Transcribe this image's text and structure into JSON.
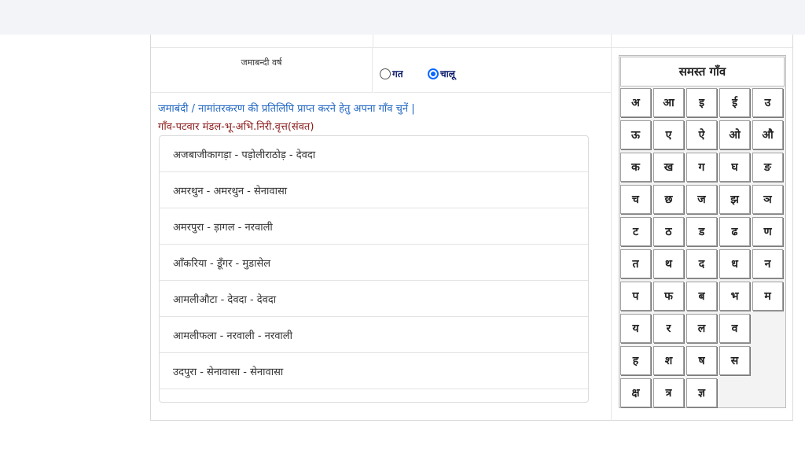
{
  "labels": {
    "year": "जमाबन्दी वर्ष"
  },
  "radios": [
    {
      "label": "गत",
      "checked": false
    },
    {
      "label": "चालू",
      "checked": true
    }
  ],
  "instructions": {
    "main": "जमाबंदी / नामांतरकरण की प्रतिलिपि प्राप्त करने हेतु अपना गाँव चुनें |",
    "sub": "गाँव-पटवार मंडल-भू-अभि.निरी.वृत्त(संवत)"
  },
  "villages": [
    "अजबाजीकागड़ा - पड़ोलीराठोड़ - देवदा",
    "अमरथुन - अमरथुन - सेनावासा",
    "अमरपुरा - ड़ागल - नरवाली",
    "आँकरिया - डूँगर - मुडासेल",
    "आमलीऔटा - देवदा - देवदा",
    "आमलीफला - नरवाली - नरवाली",
    "उदपुरा - सेनावासा - सेनावासा"
  ],
  "panel": {
    "title": "समस्त गाँव",
    "rows": [
      [
        "अ",
        "आ",
        "इ",
        "ई",
        "उ"
      ],
      [
        "ऊ",
        "ए",
        "ऐ",
        "ओ",
        "औ"
      ],
      [
        "क",
        "ख",
        "ग",
        "घ",
        "ङ"
      ],
      [
        "च",
        "छ",
        "ज",
        "झ",
        "ञ"
      ],
      [
        "ट",
        "ठ",
        "ड",
        "ढ",
        "ण"
      ],
      [
        "त",
        "थ",
        "द",
        "ध",
        "न"
      ],
      [
        "प",
        "फ",
        "ब",
        "भ",
        "म"
      ],
      [
        "य",
        "र",
        "ल",
        "व"
      ],
      [
        "ह",
        "श",
        "ष",
        "स"
      ],
      [
        "क्ष",
        "त्र",
        "ज्ञ"
      ]
    ]
  }
}
